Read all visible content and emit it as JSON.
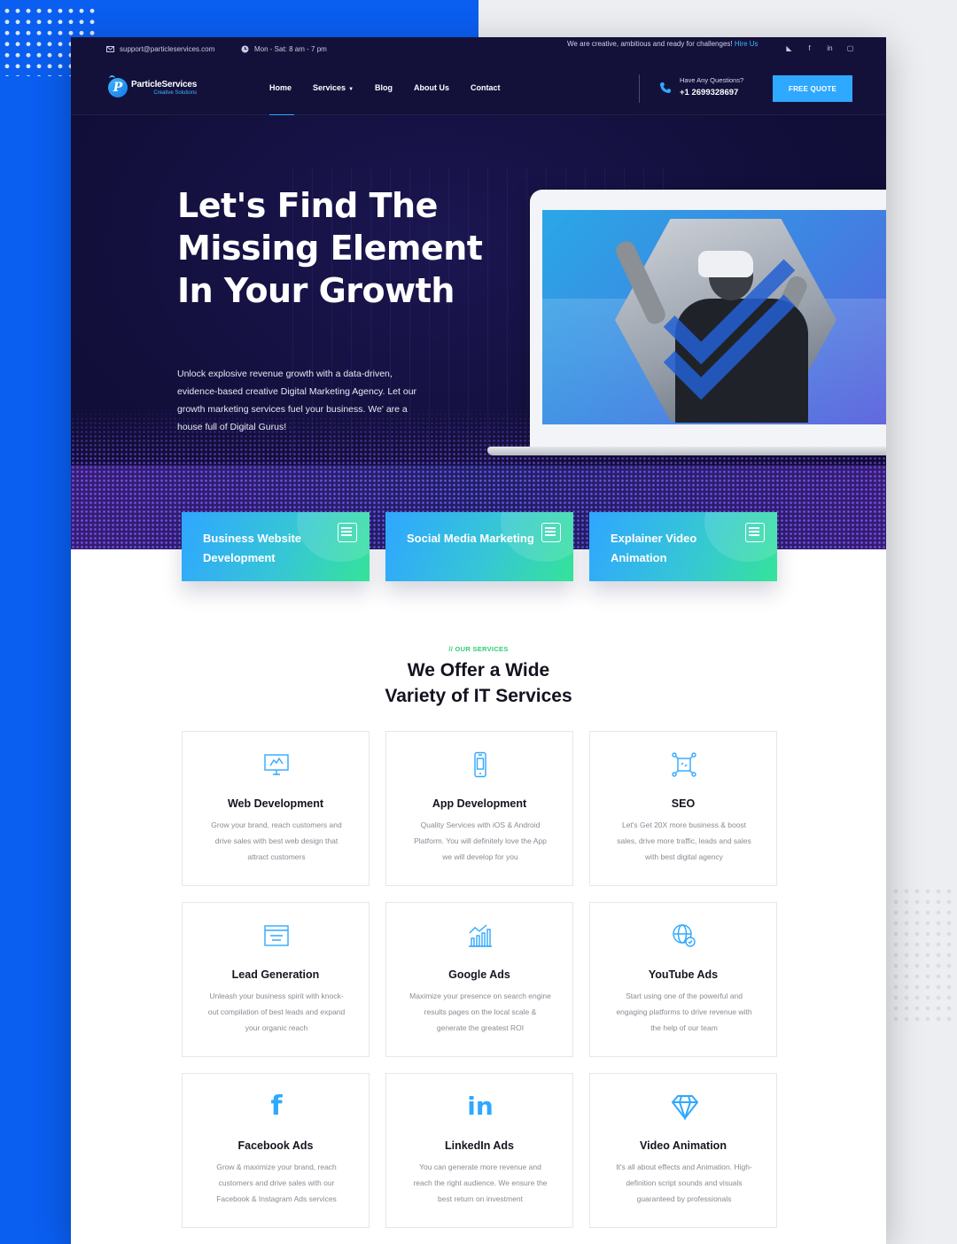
{
  "topbar": {
    "email": "support@particleservices.com",
    "hours": "Mon - Sat: 8 am - 7 pm",
    "tagline": "We are creative, ambitious and ready for challenges!",
    "tagline_link": "Hire Us",
    "social": [
      {
        "icon": "twitter-icon",
        "glyph": "◣"
      },
      {
        "icon": "facebook-icon",
        "glyph": "f"
      },
      {
        "icon": "linkedin-icon",
        "glyph": "in"
      },
      {
        "icon": "instagram-icon",
        "glyph": "▢"
      }
    ]
  },
  "logo": {
    "name": "ParticleServices",
    "sub": "Creative Solutions",
    "mark": "P"
  },
  "nav": {
    "home": "Home",
    "services": "Services",
    "blog": "Blog",
    "about": "About Us",
    "contact": "Contact"
  },
  "contact": {
    "question": "Have Any Questions?",
    "phone": "+1 2699328697"
  },
  "cta": {
    "free_quote": "FREE QUOTE"
  },
  "hero": {
    "title": "Let's Find The Missing Element In Your Growth",
    "text": "Unlock explosive revenue growth with a data-driven, evidence-based creative Digital Marketing Agency. Let our growth marketing services fuel your business. We' are a house full of Digital Gurus!"
  },
  "features": [
    {
      "title": "Business Website Development"
    },
    {
      "title": "Social Media Marketing"
    },
    {
      "title": "Explainer Video Animation"
    }
  ],
  "services": {
    "kicker": "// OUR SERVICES",
    "title_line1": "We Offer a Wide",
    "title_line2": "Variety of IT Services",
    "items": [
      {
        "name": "Web Development",
        "desc": "Grow your brand, reach customers and drive sales with best web design that attract customers",
        "icon": "monitor-icon"
      },
      {
        "name": "App Development",
        "desc": "Quality Services with iOS & Android Platform. You will definitely love the App we will develop for you",
        "icon": "mobile-icon"
      },
      {
        "name": "SEO",
        "desc": "Let's Get 20X more business & boost sales, drive more traffic, leads and sales with best digital agency",
        "icon": "seo-network-icon"
      },
      {
        "name": "Lead Generation",
        "desc": "Unleash your business spirit with knock-out compilation of best leads and expand your organic reach",
        "icon": "browser-window-icon"
      },
      {
        "name": "Google Ads",
        "desc": "Maximize your presence on search engine results pages on the local scale & generate the greatest ROI",
        "icon": "growth-chart-icon"
      },
      {
        "name": "YouTube Ads",
        "desc": "Start using one of the powerful and engaging platforms to drive revenue with the help of our team",
        "icon": "globe-badge-icon"
      },
      {
        "name": "Facebook Ads",
        "desc": "Grow & maximize your brand, reach customers and drive sales with our Facebook & Instagram Ads services",
        "icon": "facebook-icon"
      },
      {
        "name": "LinkedIn Ads",
        "desc": "You can generate more revenue and reach the right audience. We ensure the best return on investment",
        "icon": "linkedin-icon"
      },
      {
        "name": "Video Animation",
        "desc": "It's all about effects and Animation. High-definition script sounds and visuals guaranteed by professionals",
        "icon": "diamond-icon"
      }
    ]
  },
  "colors": {
    "primary_blue": "#2fa8ff",
    "dark_navy": "#13113a",
    "accent_green": "#2ecc71",
    "backdrop_blue": "#0a5ef0"
  }
}
